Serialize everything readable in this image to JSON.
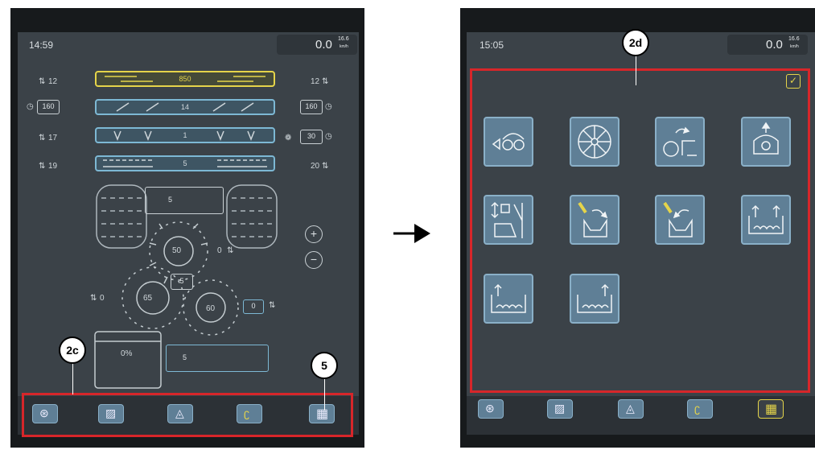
{
  "left_screen": {
    "time": "14:59",
    "speed": {
      "value": "0.0",
      "sup": "16.6",
      "unit": "km/h"
    },
    "rows": [
      {
        "left": "12",
        "value": "850",
        "right": "12"
      },
      {
        "left": "160",
        "value": "14",
        "right": "160"
      },
      {
        "left": "17",
        "value": "1",
        "right": "30"
      },
      {
        "left": "19",
        "value": "5",
        "right": "20"
      }
    ],
    "reel_value": "5",
    "rotor_top": "50",
    "rotor_top_right_label": "0",
    "rotor_mid_box": "5",
    "rotor_left": "65",
    "rotor_left_label": "0",
    "rotor_right": "60",
    "rotor_right_box": "0",
    "tank_percent": "0%",
    "bottom_box": "5",
    "callouts": {
      "a": "2c",
      "b": "5"
    }
  },
  "right_screen": {
    "time": "15:05",
    "speed": {
      "value": "0.0",
      "sup": "16.6",
      "unit": "km/h"
    },
    "callout": "2d"
  },
  "colors": {
    "accent": "#7db8d4",
    "highlight": "#e5d44a",
    "frame": "#d7262a"
  }
}
